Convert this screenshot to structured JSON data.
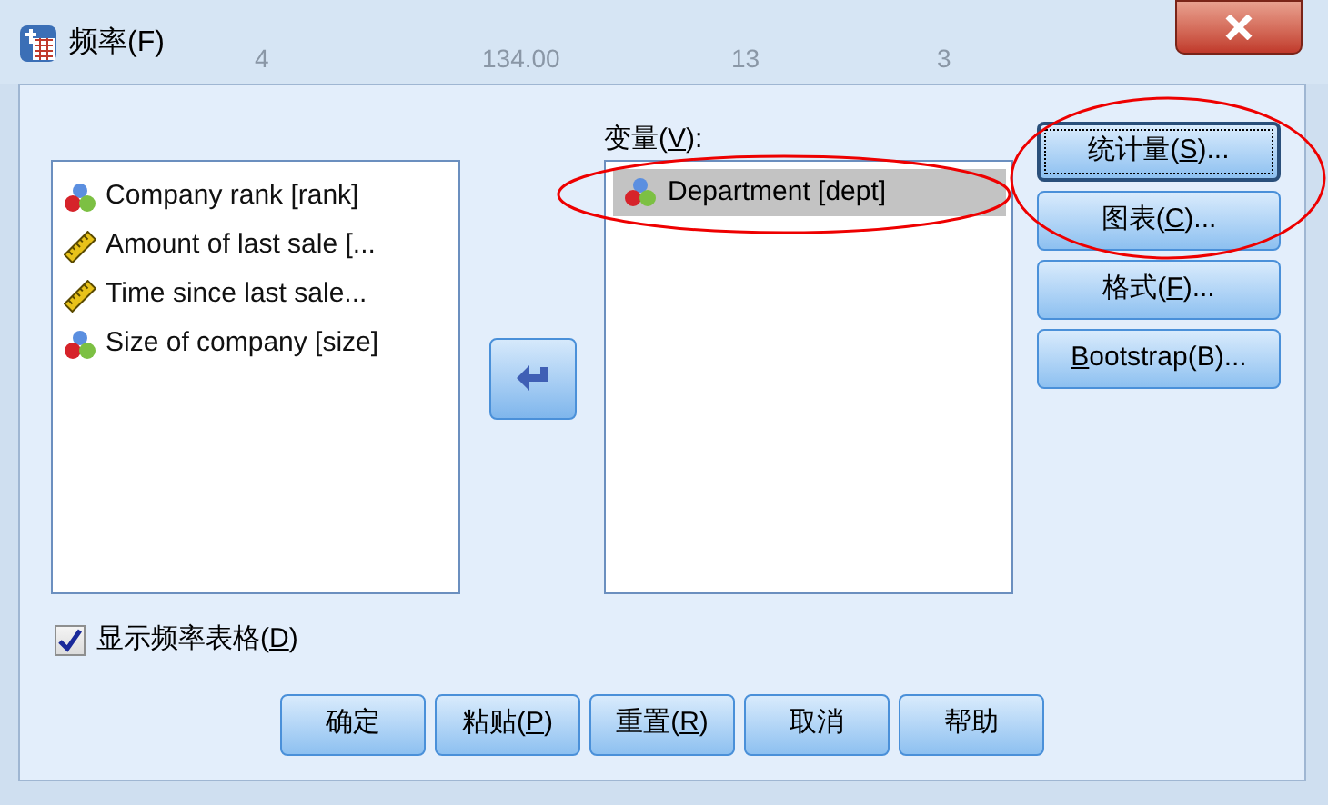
{
  "background_table_row": [
    "4",
    "134.00",
    "13",
    "3"
  ],
  "window": {
    "title": "频率(F)"
  },
  "source_list": {
    "items": [
      {
        "kind": "nominal",
        "label": "Company rank [rank]"
      },
      {
        "kind": "scale",
        "label": "Amount of last sale [..."
      },
      {
        "kind": "scale",
        "label": "Time since last sale..."
      },
      {
        "kind": "nominal",
        "label": "Size of company [size]"
      }
    ]
  },
  "variables": {
    "label_parts": [
      "变量(",
      "V",
      "):"
    ],
    "items": [
      {
        "kind": "nominal",
        "label": "Department [dept]",
        "selected": true
      }
    ]
  },
  "side_buttons": [
    {
      "label_parts": [
        "统计量(",
        "S",
        ")..."
      ],
      "focused": true
    },
    {
      "label_parts": [
        "图表(",
        "C",
        ")..."
      ],
      "focused": false
    },
    {
      "label_parts": [
        "格式(",
        "F",
        ")..."
      ],
      "focused": false
    },
    {
      "label_parts": [
        "B",
        "ootstrap(B)..."
      ],
      "mnemonic_first": true,
      "focused": false
    }
  ],
  "display_table": {
    "label_parts": [
      "显示频率表格(",
      "D",
      ")"
    ],
    "checked": true
  },
  "bottom_buttons": [
    {
      "label_parts": [
        "确定"
      ]
    },
    {
      "label_parts": [
        "粘贴(",
        "P",
        ")"
      ]
    },
    {
      "label_parts": [
        "重置(",
        "R",
        ")"
      ]
    },
    {
      "label_parts": [
        "取消"
      ]
    },
    {
      "label_parts": [
        "帮助"
      ]
    }
  ]
}
